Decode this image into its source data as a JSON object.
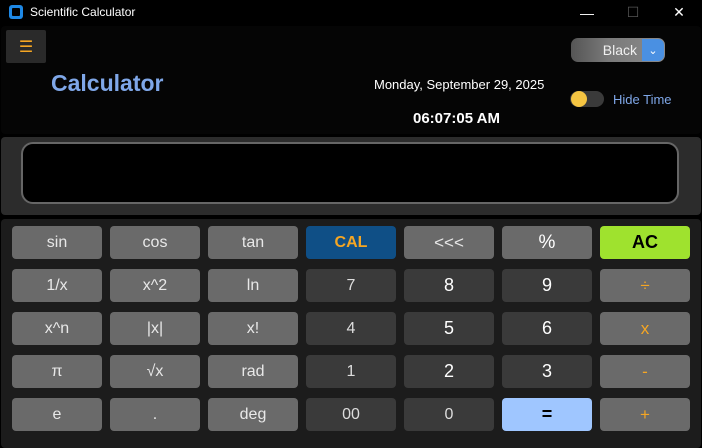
{
  "window": {
    "title": "Scientific Calculator",
    "minimize_glyph": "—",
    "maximize_glyph": "☐",
    "close_glyph": "✕"
  },
  "header": {
    "menu_icon": "☰",
    "app_title": "Calculator",
    "date": "Monday, September 29, 2025",
    "time": "06:07:05 AM",
    "theme": {
      "selected": "Black",
      "chevron": "⌄"
    },
    "time_toggle_label": "Hide Time"
  },
  "display": {
    "value": ""
  },
  "keypad": {
    "sin": "sin",
    "cos": "cos",
    "tan": "tan",
    "cal": "CAL",
    "backspace": "<<<",
    "percent": "%",
    "ac": "AC",
    "reciprocal": "1/x",
    "square": "x^2",
    "ln": "ln",
    "seven": "7",
    "eight": "8",
    "nine": "9",
    "divide": "÷",
    "power": "x^n",
    "abs": "|x|",
    "factorial": "x!",
    "four": "4",
    "five": "5",
    "six": "6",
    "multiply": "x",
    "pi": "π",
    "sqrt": "√x",
    "rad": "rad",
    "one": "1",
    "two": "2",
    "three": "3",
    "subtract": "-",
    "e": "e",
    "dot": ".",
    "deg": "deg",
    "double_zero": "00",
    "zero": "0",
    "equals": "=",
    "add": "+"
  },
  "colors": {
    "accent_orange": "#f5a623",
    "title_blue": "#7fa7e8",
    "ac_green": "#9fe22e",
    "equals_blue": "#9fc6ff",
    "cal_blue": "#0f4f86"
  }
}
